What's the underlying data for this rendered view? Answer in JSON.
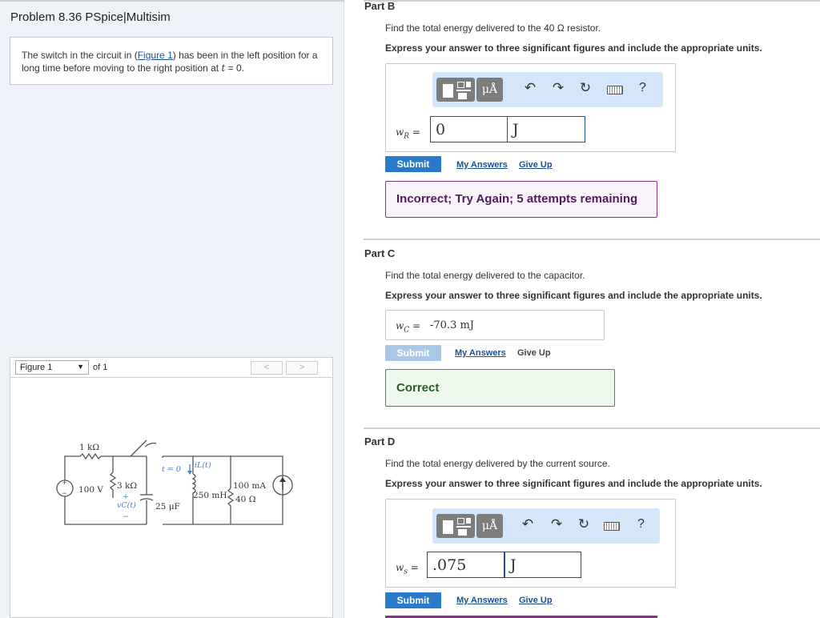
{
  "left": {
    "problem_title": "Problem 8.36 PSpice|Multisim",
    "problem_text_1": "The switch in the circuit in (",
    "figure_link": "Figure 1",
    "problem_text_2": ") has been in the left position for a long time before moving to the right position at ",
    "problem_text_t": "t",
    "problem_text_3": " = 0.",
    "figure_select": "Figure 1",
    "figure_of": "of 1",
    "prev": "<",
    "next": ">"
  },
  "circuit": {
    "r1": "1 kΩ",
    "r3": "3 kΩ",
    "v100": "100 V",
    "t0": "t = 0",
    "il": "iL(t)",
    "vc": "vC(t)",
    "plus": "+",
    "minus": "−",
    "c": "25 μF",
    "l": "250 mH",
    "i_src": "100 mA",
    "r40": "40 Ω"
  },
  "partB": {
    "title": "Part B",
    "question": "Find the total energy delivered to the 40 Ω resistor.",
    "instruction": "Express your answer to three significant figures and include the appropriate units.",
    "toolbar_units": "μÅ",
    "help": "?",
    "var": "w",
    "var_sub": "R",
    "equals": "=",
    "value": "0",
    "unit": "J",
    "submit": "Submit",
    "my_answers": "My Answers",
    "give_up": "Give Up",
    "feedback": "Incorrect; Try Again; 5 attempts remaining"
  },
  "partC": {
    "title": "Part C",
    "question": "Find the total energy delivered to the capacitor.",
    "instruction": "Express your answer to three significant figures and include the appropriate units.",
    "var": "w",
    "var_sub": "C",
    "equals": "=",
    "answer": "-70.3 mJ",
    "submit": "Submit",
    "my_answers": "My Answers",
    "give_up": "Give Up",
    "feedback": "Correct"
  },
  "partD": {
    "title": "Part D",
    "question": "Find the total energy delivered by the current source.",
    "instruction": "Express your answer to three significant figures and include the appropriate units.",
    "toolbar_units": "μÅ",
    "help": "?",
    "var": "w",
    "var_sub": "s",
    "equals": "=",
    "value": ".075",
    "unit": "J",
    "submit": "Submit",
    "my_answers": "My Answers",
    "give_up": "Give Up"
  },
  "colors": {
    "accent": "#2b79c9",
    "toolbar_bg": "#d3e6fa",
    "incorrect_border": "#8a2f8e",
    "correct_border": "#3a9a3a"
  }
}
